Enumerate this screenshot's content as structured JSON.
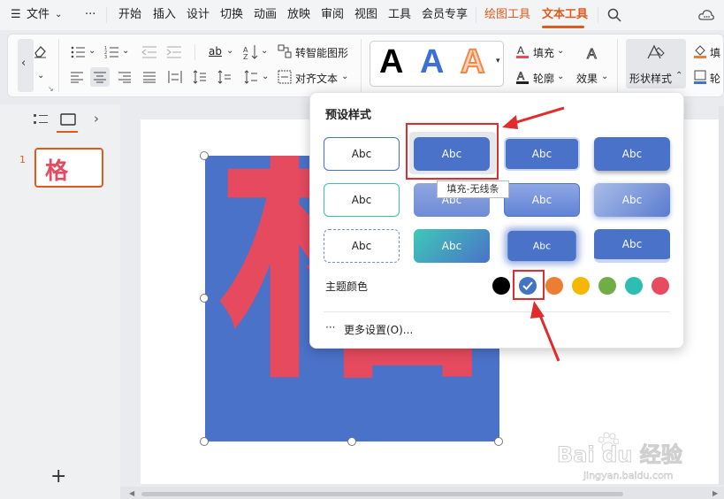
{
  "menu": {
    "file_label": "文件",
    "tabs": [
      {
        "label": "开始"
      },
      {
        "label": "插入"
      },
      {
        "label": "设计"
      },
      {
        "label": "切换"
      },
      {
        "label": "动画"
      },
      {
        "label": "放映"
      },
      {
        "label": "审阅"
      },
      {
        "label": "视图"
      },
      {
        "label": "工具"
      },
      {
        "label": "会员专享"
      },
      {
        "label": "绘图工具"
      },
      {
        "label": "文本工具"
      }
    ],
    "active_tab": "文本工具"
  },
  "ribbon": {
    "smart_shape": "转智能图形",
    "align_text": "对齐文本",
    "fill": "填充",
    "outline": "轮廓",
    "effects": "效果",
    "shape_style": "形状样式",
    "fill_right": "填",
    "outline_right": "轮",
    "art_letters": [
      "A",
      "A",
      "A"
    ]
  },
  "slides": {
    "slide_number": "1",
    "thumb_text": "格",
    "add_symbol": "+"
  },
  "canvas": {
    "glyph_text": "格"
  },
  "dropdown": {
    "title": "预设样式",
    "swatch_label": "Abc",
    "tooltip": "填充-无线条",
    "theme_colors_label": "主题颜色",
    "more_settings": "更多设置(O)...",
    "theme_colors": [
      "#000000",
      "#4472c4",
      "#ed7d31",
      "#f5b800",
      "#70ad47",
      "#2ebdb1",
      "#e84a5f"
    ],
    "selected_color_index": 1
  },
  "watermark": {
    "text": "Bai du 经验",
    "url": "jingyan.baidu.com"
  },
  "colors": {
    "accent": "#e05a1e",
    "shape_fill": "#4a72c8",
    "glyph": "#e64a5f",
    "annotation": "#e02c2c"
  }
}
